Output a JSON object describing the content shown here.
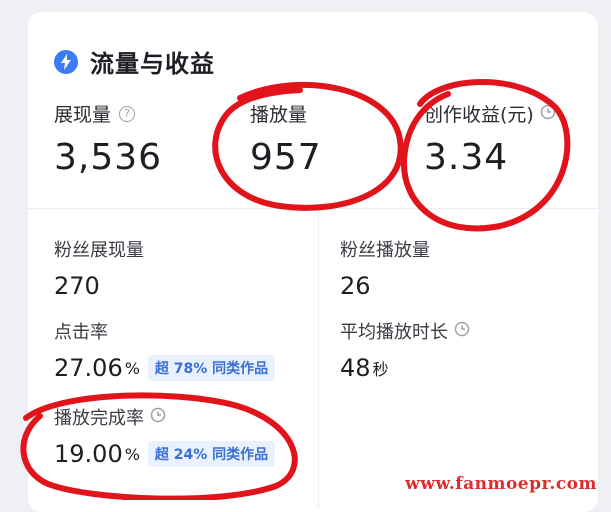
{
  "title": "流量与收益",
  "top_metrics": [
    {
      "label": "展现量",
      "value": "3,536"
    },
    {
      "label": "播放量",
      "value": "957"
    },
    {
      "label": "创作收益(元)",
      "value": "3.34"
    }
  ],
  "stats": {
    "fan_impressions": {
      "label": "粉丝展现量",
      "value": "270"
    },
    "fan_plays": {
      "label": "粉丝播放量",
      "value": "26"
    },
    "ctr": {
      "label": "点击率",
      "value": "27.06",
      "unit": "%",
      "badge": "超 78% 同类作品"
    },
    "avg_duration": {
      "label": "平均播放时长",
      "value": "48",
      "unit": "秒"
    },
    "completion": {
      "label": "播放完成率",
      "value": "19.00",
      "unit": "%",
      "badge": "超 24% 同类作品"
    }
  },
  "watermark": "www.fanmoepr.com",
  "colors": {
    "accent": "#3b7cf5",
    "annotation": "#e1141c",
    "badge_bg": "#e9f1fe"
  }
}
